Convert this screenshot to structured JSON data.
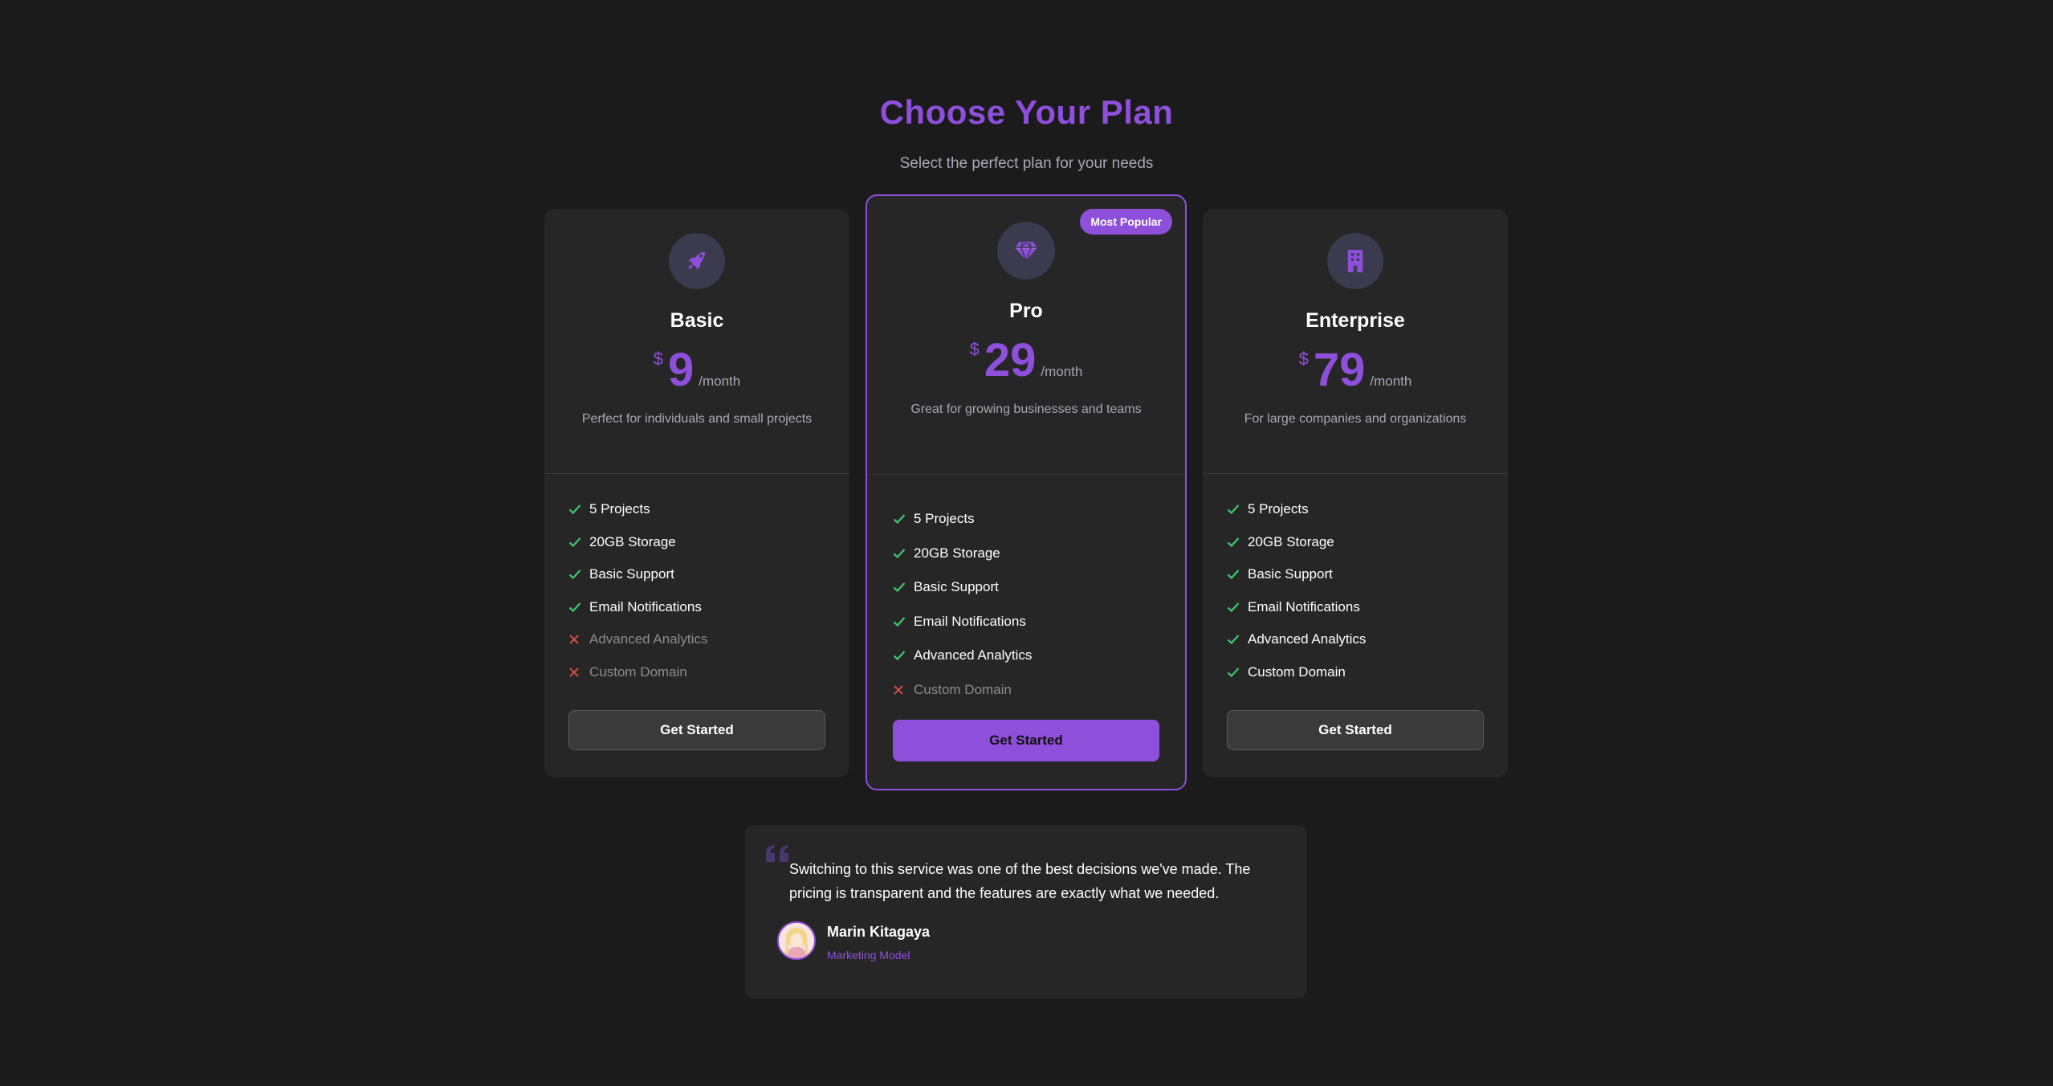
{
  "header": {
    "title": "Choose Your Plan",
    "subtitle": "Select the perfect plan for your needs"
  },
  "colors": {
    "accent": "#8e4fdb",
    "check": "#3ec46d",
    "cross": "#d34a4a",
    "background": "#1b1b1b",
    "card": "#262626"
  },
  "plans": [
    {
      "name": "Basic",
      "icon": "rocket-icon",
      "currency": "$",
      "price": "9",
      "period": "/month",
      "description": "Perfect for individuals and small projects",
      "features": [
        {
          "label": "5 Projects",
          "included": true
        },
        {
          "label": "20GB Storage",
          "included": true
        },
        {
          "label": "Basic Support",
          "included": true
        },
        {
          "label": "Email Notifications",
          "included": true
        },
        {
          "label": "Advanced Analytics",
          "included": false
        },
        {
          "label": "Custom Domain",
          "included": false
        }
      ],
      "button_label": "Get Started"
    },
    {
      "name": "Pro",
      "icon": "gem-icon",
      "badge": "Most Popular",
      "currency": "$",
      "price": "29",
      "period": "/month",
      "description": "Great for growing businesses and teams",
      "features": [
        {
          "label": "5 Projects",
          "included": true
        },
        {
          "label": "20GB Storage",
          "included": true
        },
        {
          "label": "Basic Support",
          "included": true
        },
        {
          "label": "Email Notifications",
          "included": true
        },
        {
          "label": "Advanced Analytics",
          "included": true
        },
        {
          "label": "Custom Domain",
          "included": false
        }
      ],
      "button_label": "Get Started"
    },
    {
      "name": "Enterprise",
      "icon": "building-icon",
      "currency": "$",
      "price": "79",
      "period": "/month",
      "description": "For large companies and organizations",
      "features": [
        {
          "label": "5 Projects",
          "included": true
        },
        {
          "label": "20GB Storage",
          "included": true
        },
        {
          "label": "Basic Support",
          "included": true
        },
        {
          "label": "Email Notifications",
          "included": true
        },
        {
          "label": "Advanced Analytics",
          "included": true
        },
        {
          "label": "Custom Domain",
          "included": true
        }
      ],
      "button_label": "Get Started"
    }
  ],
  "testimonial": {
    "quote": "Switching to this service was one of the best decisions we've made. The pricing is transparent and the features are exactly what we needed.",
    "author_name": "Marin Kitagaya",
    "author_role": "Marketing Model"
  }
}
